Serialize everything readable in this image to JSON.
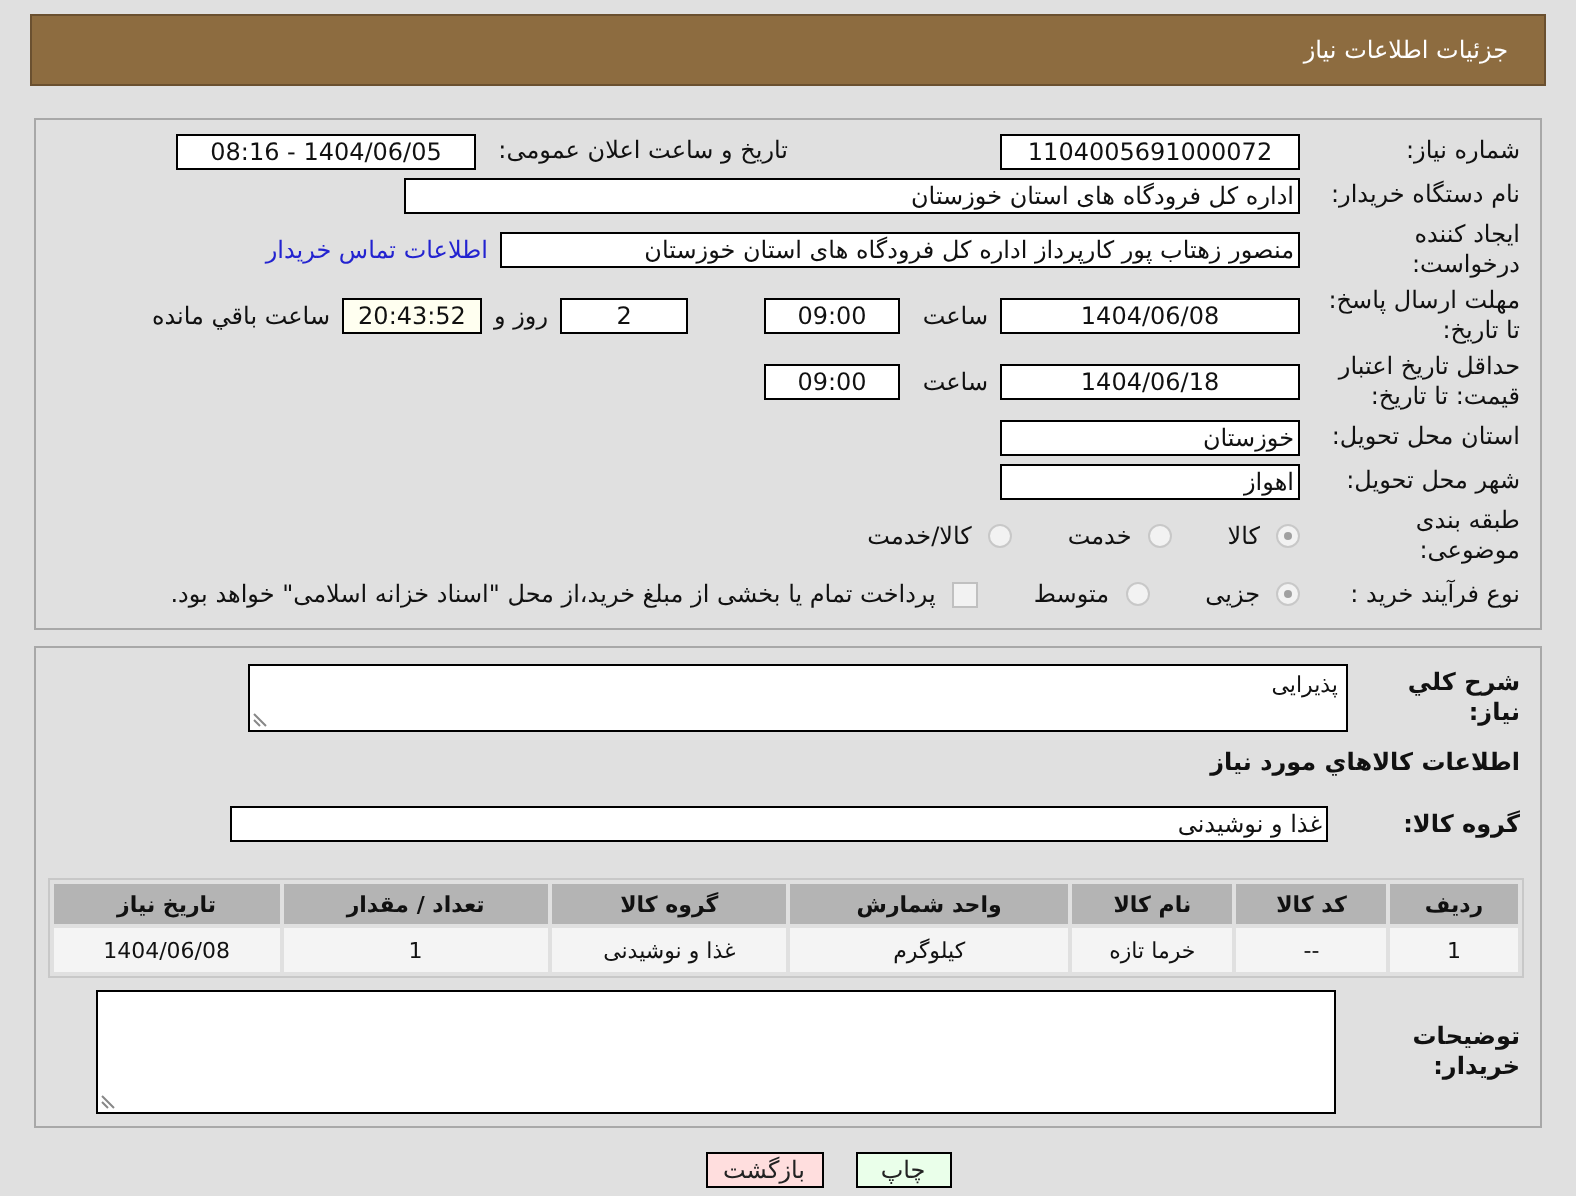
{
  "header": {
    "title": "جزئیات اطلاعات نیاز"
  },
  "need_number": {
    "label": "شماره نیاز:",
    "value": "1104005691000072"
  },
  "announce": {
    "label": "تاریخ و ساعت اعلان عمومی:",
    "value": "1404/06/05 - 08:16"
  },
  "buyer": {
    "label": "نام دستگاه خریدار:",
    "value": "اداره کل فرودگاه های استان خوزستان"
  },
  "creator": {
    "label": "ایجاد کننده درخواست:",
    "value": "منصور زهتاب پور کارپرداز اداره کل فرودگاه های استان خوزستان",
    "link": "اطلاعات تماس خریدار"
  },
  "deadline": {
    "label": "مهلت ارسال پاسخ: تا تاریخ:",
    "date": "1404/06/08",
    "time_label": "ساعت",
    "time": "09:00",
    "days": "2",
    "days_label": "روز و",
    "remaining": "20:43:52",
    "remaining_label": "ساعت باقي مانده"
  },
  "validity": {
    "label": "حداقل تاریخ اعتبار قیمت: تا تاریخ:",
    "date": "1404/06/18",
    "time_label": "ساعت",
    "time": "09:00"
  },
  "province": {
    "label": "استان محل تحویل:",
    "value": "خوزستان"
  },
  "city": {
    "label": "شهر محل تحویل:",
    "value": "اهواز"
  },
  "category": {
    "label": "طبقه بندی موضوعی:",
    "options": [
      {
        "label": "کالا",
        "selected": true
      },
      {
        "label": "خدمت",
        "selected": false
      },
      {
        "label": "کالا/خدمت",
        "selected": false
      }
    ]
  },
  "process": {
    "label": "نوع فرآیند خرید :",
    "options": [
      {
        "label": "جزیی",
        "selected": true
      },
      {
        "label": "متوسط",
        "selected": false
      }
    ],
    "treasury": {
      "label": "پرداخت تمام یا بخشی از مبلغ خرید،از محل \"اسناد خزانه اسلامی\" خواهد بود.",
      "checked": false
    }
  },
  "description": {
    "label": "شرح کلي نياز:",
    "value": "پذیرایی"
  },
  "goods_title": "اطلاعات کالاهاي مورد نياز",
  "goods_group": {
    "label": "گروه کالا:",
    "value": "غذا و نوشیدنی"
  },
  "table": {
    "columns": [
      "ردیف",
      "کد کالا",
      "نام کالا",
      "واحد شمارش",
      "گروه کالا",
      "تعداد / مقدار",
      "تاریخ نیاز"
    ],
    "rows": [
      [
        "1",
        "--",
        "خرما تازه",
        "کیلوگرم",
        "غذا و نوشیدنی",
        "1",
        "1404/06/08"
      ]
    ]
  },
  "buyer_notes": {
    "label": "توضیحات خریدار:"
  },
  "buttons": [
    {
      "label": "چاپ",
      "kind": "print"
    },
    {
      "label": "بازگشت",
      "kind": "back"
    }
  ]
}
